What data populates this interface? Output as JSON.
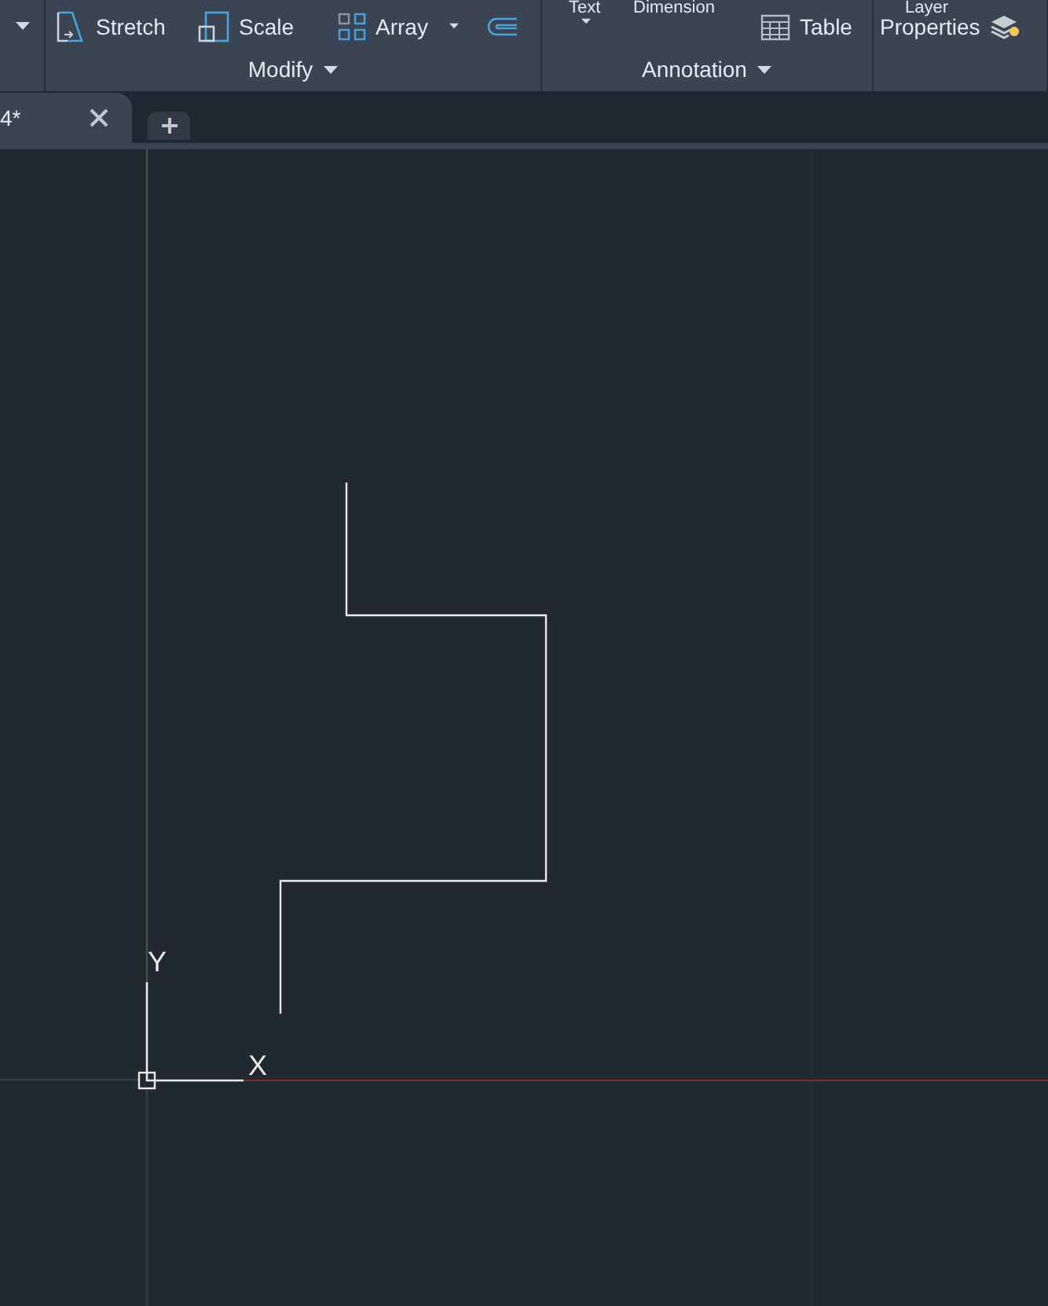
{
  "ribbon": {
    "panels": [
      {
        "kind": "modify",
        "label": "Modify",
        "tools": [
          {
            "kind": "stretch",
            "label": "Stretch"
          },
          {
            "kind": "scale",
            "label": "Scale"
          },
          {
            "kind": "array",
            "label": "Array"
          }
        ]
      },
      {
        "kind": "annotation",
        "label": "Annotation",
        "top_labels": [
          "Text",
          "Dimension"
        ],
        "tools": [
          {
            "kind": "table",
            "label": "Table"
          }
        ]
      },
      {
        "kind": "layer",
        "top_labels": [
          "Layer"
        ],
        "tools": [
          {
            "kind": "layer",
            "label": "Properties"
          }
        ]
      }
    ]
  },
  "tabs": [
    {
      "label": "4*",
      "selected": true
    }
  ],
  "canvas": {
    "ucs": {
      "y_label": "Y",
      "x_label": "X"
    }
  }
}
